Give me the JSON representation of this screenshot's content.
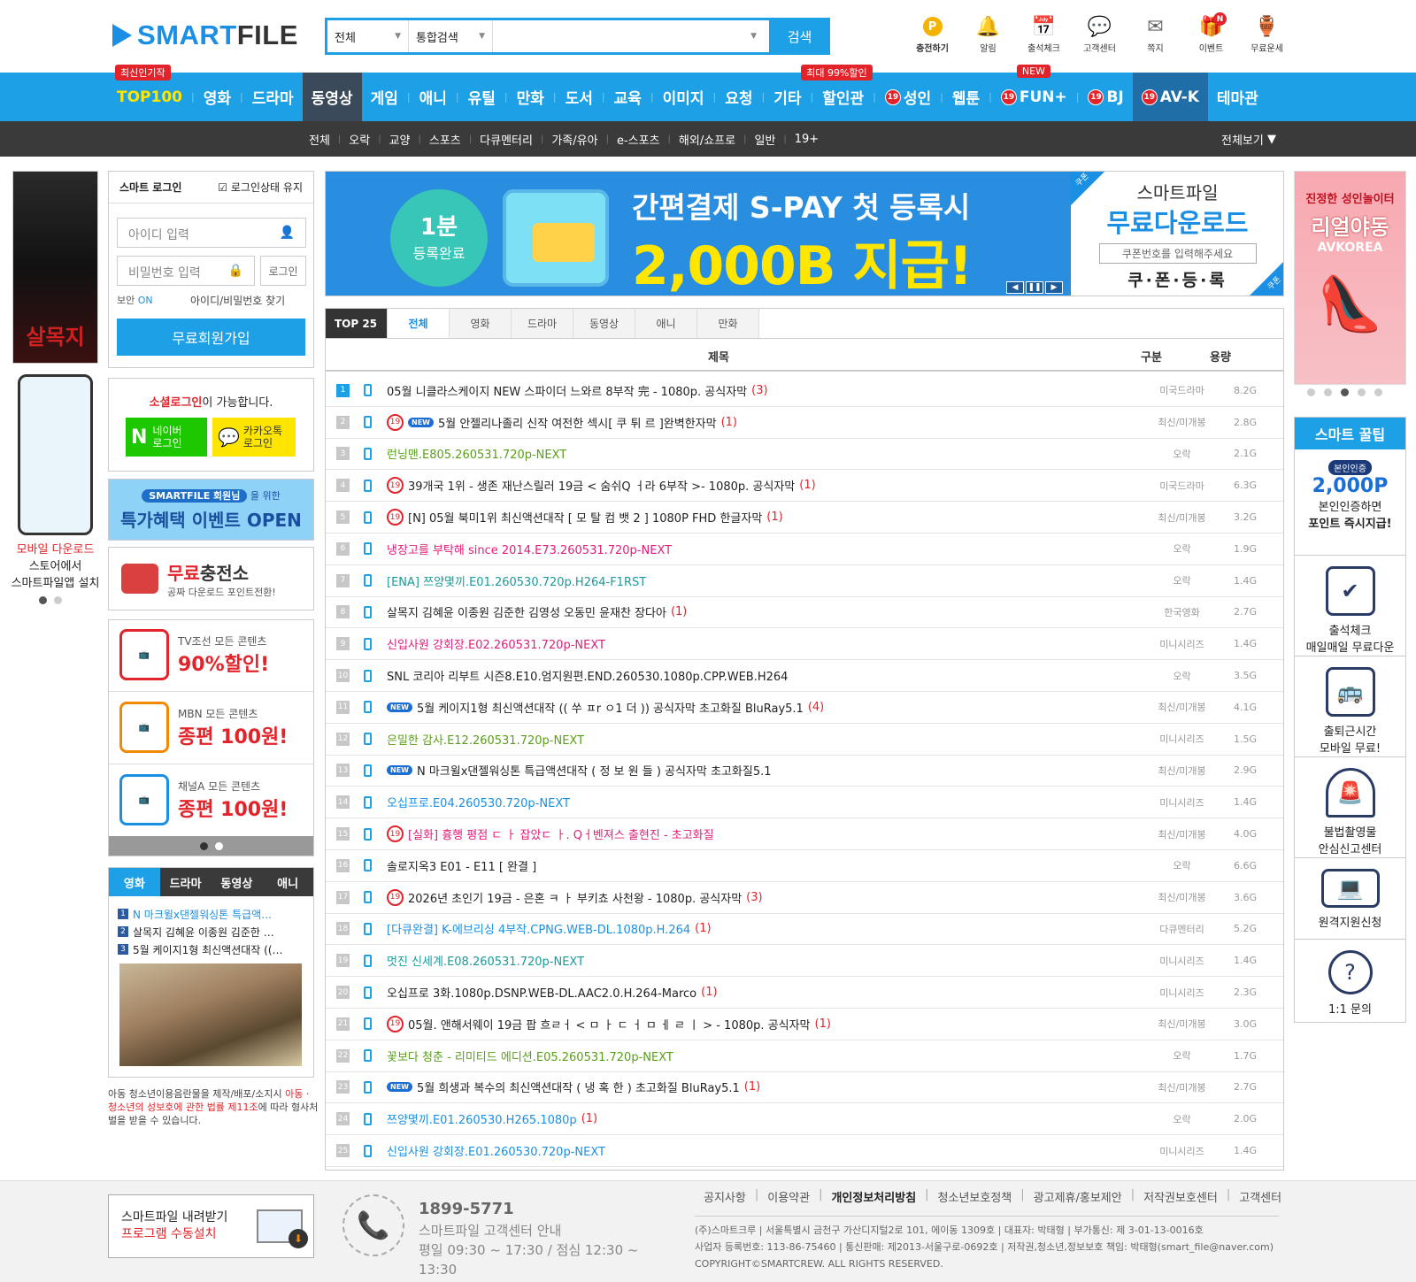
{
  "brand": {
    "name_a": "SMART",
    "name_b": "FILE",
    "primary": "#1ea0e6",
    "red": "#e2242a"
  },
  "search": {
    "scope": "전체",
    "type": "통합검색",
    "value": "",
    "button": "검색"
  },
  "top_icons": [
    {
      "icon": "point-icon",
      "label": "충전하기"
    },
    {
      "icon": "bell-icon",
      "label": "알림"
    },
    {
      "icon": "calendar-icon",
      "label": "출석체크"
    },
    {
      "icon": "chat-icon",
      "label": "고객센터"
    },
    {
      "icon": "mail-icon",
      "label": "쪽지"
    },
    {
      "icon": "gift-icon",
      "label": "이벤트",
      "badge": "N"
    },
    {
      "icon": "fortune-icon",
      "label": "무료운세"
    }
  ],
  "nav": {
    "items": [
      "TOP100",
      "영화",
      "드라마",
      "동영상",
      "게임",
      "애니",
      "유틸",
      "만화",
      "도서",
      "교육",
      "이미지",
      "요청",
      "기타",
      "할인관",
      "성인",
      "웹툰",
      "FUN+",
      "BJ",
      "AV-K",
      "테마관"
    ],
    "tag_top": "최신인기작",
    "tag_discount": "최대 99%할인",
    "tag_new": "NEW",
    "badge19": "19"
  },
  "subnav": {
    "items": [
      "전체",
      "오락",
      "교양",
      "스포츠",
      "다큐멘터리",
      "가족/유아",
      "e-스포츠",
      "해외/쇼프로",
      "일반",
      "19+"
    ],
    "view_all": "전체보기"
  },
  "left": {
    "poster_title": "살목지",
    "mobile": {
      "line1": "모바일 다운로드",
      "line2": "스토어에서",
      "line3": "스마트파일앱 설치"
    },
    "login": {
      "title": "스마트 로그인",
      "keep": "로그인상태 유지",
      "id_placeholder": "아이디 입력",
      "pw_placeholder": "비밀번호 입력",
      "button": "로그인",
      "sec_label": "보안",
      "sec_value": "ON",
      "find": "아이디/비밀번호 찾기",
      "join": "무료회원가입"
    },
    "social": {
      "title_red": "소셜로그인",
      "title_rest": "이 가능합니다.",
      "naver": "네이버\n로그인",
      "kakao": "카카오톡\n로그인"
    },
    "event": {
      "pill": "SMARTFILE 회원님",
      "pill_tail": "을 위한",
      "title": "특가혜택 이벤트 OPEN"
    },
    "free": {
      "title_red": "무료",
      "title_rest": "충전소",
      "sub": "공짜 다운로드 포인트전환!"
    },
    "promos": [
      {
        "logo": "TV조선",
        "line1": "TV조선 모든 콘텐츠",
        "line2": "90%할인!",
        "color": "#e2242a"
      },
      {
        "logo": "MBN",
        "line1": "MBN 모든 콘텐츠",
        "line2": "종편 100원!",
        "color": "#f08a00"
      },
      {
        "logo": "Channel A",
        "line1": "채널A 모든 콘텐츠",
        "line2": "종편 100원!",
        "color": "#1a8fe3"
      }
    ],
    "mini_tabs": [
      "영화",
      "드라마",
      "동영상",
      "애니"
    ],
    "mini_list": [
      "N 마크윌x댄젤워싱톤 특급액…",
      "살목지 김혜윤 이종원 김준한 …",
      "5월 케이지1형 최신액션대작 ((…"
    ],
    "notice_a": "아동 청소년이용음란물을 제작/배포/소지시",
    "notice_b": "아동 · 청소년의 성보호에 관한 법률 제11조",
    "notice_c": "에 따라 형사처벌을 받을 수 있습니다."
  },
  "hero": {
    "circle_a": "1분",
    "circle_b": "등록완료",
    "line1": "간편결제 S-PAY 첫 등록시",
    "line2": "2,000B 지급!",
    "coupon_a": "스마트파일",
    "coupon_b": "무료다운로드",
    "coupon_input": "쿠폰번호를 입력해주세요",
    "coupon_btn": "쿠·폰·등·록",
    "ribbon": "쿠폰"
  },
  "top25": {
    "label": "TOP 25",
    "tabs": [
      "전체",
      "영화",
      "드라마",
      "동영상",
      "애니",
      "만화"
    ],
    "col_title": "제목",
    "col_cat": "구분",
    "col_size": "용량"
  },
  "rows": [
    {
      "n": "1",
      "t": "05월 니클라스케이지 NEW 스파이더 느와르 8부작 完 - 1080p. 공식자막",
      "c": "(3)",
      "cat": "미국드라마",
      "sz": "8.2G",
      "col": "#222",
      "r19": false,
      "new": false
    },
    {
      "n": "2",
      "t": "5월 안젤리나졸리 신작 여전한 섹시[ 쿠 튀 르 ]완벽한자막",
      "c": "(1)",
      "cat": "최신/미개봉",
      "sz": "2.8G",
      "col": "#222",
      "r19": true,
      "new": true
    },
    {
      "n": "3",
      "t": "런닝맨.E805.260531.720p-NEXT",
      "c": "",
      "cat": "오락",
      "sz": "2.1G",
      "col": "#5a9e1a",
      "r19": false,
      "new": false
    },
    {
      "n": "4",
      "t": "39개국 1위 - 생존 재난스릴러 19금 < 숨쉬Q ㅓ라 6부작 >- 1080p. 공식자막",
      "c": "(1)",
      "cat": "미국드라마",
      "sz": "6.3G",
      "col": "#222",
      "r19": true,
      "new": false
    },
    {
      "n": "5",
      "t": "[N] 05월 북미1위 최신액션대작 [ 모 탈 컴 뱃 2 ] 1080P FHD 한글자막",
      "c": "(1)",
      "cat": "최신/미개봉",
      "sz": "3.2G",
      "col": "#222",
      "r19": true,
      "new": false
    },
    {
      "n": "6",
      "t": "냉장고를 부탁해 since 2014.E73.260531.720p-NEXT",
      "c": "",
      "cat": "오락",
      "sz": "1.9G",
      "col": "#e01e78",
      "r19": false,
      "new": false
    },
    {
      "n": "7",
      "t": "[ENA] 쯔양몇끼.E01.260530.720p.H264-F1RST",
      "c": "",
      "cat": "오락",
      "sz": "1.4G",
      "col": "#1a9a9a",
      "r19": false,
      "new": false
    },
    {
      "n": "8",
      "t": "살목지 김혜윤 이종원 김준한 김영성 오동민 윤재찬 장다아",
      "c": "(1)",
      "cat": "한국영화",
      "sz": "2.7G",
      "col": "#222",
      "r19": false,
      "new": false
    },
    {
      "n": "9",
      "t": "신입사원 강회장.E02.260531.720p-NEXT",
      "c": "",
      "cat": "미니시리즈",
      "sz": "1.4G",
      "col": "#e01e78",
      "r19": false,
      "new": false
    },
    {
      "n": "10",
      "t": "SNL 코리아 리부트 시즌8.E10.엄지원편.END.260530.1080p.CPP.WEB.H264",
      "c": "",
      "cat": "오락",
      "sz": "3.5G",
      "col": "#222",
      "r19": false,
      "new": false
    },
    {
      "n": "11",
      "t": "5월 케이지1형 최신액션대작 (( 쑤 ㅍr ㅇ1 더 )) 공식자막 초고화질 BluRay5.1",
      "c": "(4)",
      "cat": "최신/미개봉",
      "sz": "4.1G",
      "col": "#222",
      "r19": false,
      "new": true
    },
    {
      "n": "12",
      "t": "은밀한 감사.E12.260531.720p-NEXT",
      "c": "",
      "cat": "미니시리즈",
      "sz": "1.5G",
      "col": "#5a9e1a",
      "r19": false,
      "new": false
    },
    {
      "n": "13",
      "t": "N 마크윌x댄젤워싱톤 특급액션대작 ( 정 보 원 들 ) 공식자막 초고화질5.1",
      "c": "",
      "cat": "최신/미개봉",
      "sz": "2.9G",
      "col": "#222",
      "r19": false,
      "new": true
    },
    {
      "n": "14",
      "t": "오십프로.E04.260530.720p-NEXT",
      "c": "",
      "cat": "미니시리즈",
      "sz": "1.4G",
      "col": "#1a8fe3",
      "r19": false,
      "new": false
    },
    {
      "n": "15",
      "t": "[실화] 흉행 평점 ㄷ ㅏ 잡았ㄷ ㅏ. Qㅓ벤져스 출현진 - 초고화질",
      "c": "",
      "cat": "최신/미개봉",
      "sz": "4.0G",
      "col": "#e01e78",
      "r19": true,
      "new": false
    },
    {
      "n": "16",
      "t": "솔로지옥3 E01 - E11 [ 완결 ]",
      "c": "",
      "cat": "오락",
      "sz": "6.6G",
      "col": "#222",
      "r19": false,
      "new": false
    },
    {
      "n": "17",
      "t": "2026년 초인기 19금 - 은혼 ㅋ ㅏ 부키쵸 사천왕 - 1080p. 공식자막",
      "c": "(3)",
      "cat": "최신/미개봉",
      "sz": "3.6G",
      "col": "#222",
      "r19": true,
      "new": false
    },
    {
      "n": "18",
      "t": "[다큐완결] K-에브리싱 4부작.CPNG.WEB-DL.1080p.H.264",
      "c": "(1)",
      "cat": "다큐멘터리",
      "sz": "5.2G",
      "col": "#1a8fe3",
      "r19": false,
      "new": false
    },
    {
      "n": "19",
      "t": "멋진 신세계.E08.260531.720p-NEXT",
      "c": "",
      "cat": "미니시리즈",
      "sz": "1.4G",
      "col": "#1a9a9a",
      "r19": false,
      "new": false
    },
    {
      "n": "20",
      "t": "오십프로 3화.1080p.DSNP.WEB-DL.AAC2.0.H.264-Marco",
      "c": "(1)",
      "cat": "미니시리즈",
      "sz": "2.3G",
      "col": "#222",
      "r19": false,
      "new": false
    },
    {
      "n": "21",
      "t": "05월. 앤해서웨이 19금 팝 흐ㄹㅓ < ㅁ ㅏ ㄷ ㅓ ㅁ ㅔ ㄹ ㅣ > - 1080p. 공식자막",
      "c": "(1)",
      "cat": "최신/미개봉",
      "sz": "3.0G",
      "col": "#222",
      "r19": true,
      "new": false
    },
    {
      "n": "22",
      "t": "꽃보다 청춘 - 리미티드 에디션.E05.260531.720p-NEXT",
      "c": "",
      "cat": "오락",
      "sz": "1.7G",
      "col": "#5a9e1a",
      "r19": false,
      "new": false
    },
    {
      "n": "23",
      "t": "5월 희생과 복수의 최신액션대작 ( 냉 혹 한 ) 초고화질 BluRay5.1",
      "c": "(1)",
      "cat": "최신/미개봉",
      "sz": "2.7G",
      "col": "#222",
      "r19": false,
      "new": true
    },
    {
      "n": "24",
      "t": "쯔양몇끼.E01.260530.H265.1080p",
      "c": "(1)",
      "cat": "오락",
      "sz": "2.0G",
      "col": "#1a8fe3",
      "r19": false,
      "new": false
    },
    {
      "n": "25",
      "t": "신입사원 강회장.E01.260530.720p-NEXT",
      "c": "",
      "cat": "미니시리즈",
      "sz": "1.4G",
      "col": "#1a8fe3",
      "r19": false,
      "new": false
    }
  ],
  "right": {
    "banner_a": "진정한 성인놀이터",
    "banner_b": "리얼야동",
    "banner_c": "AVKOREA",
    "tips_title": "스마트 꿀팁",
    "tips": [
      {
        "icon": "point-badge-icon",
        "a": "본인인증",
        "pt": "2,000P",
        "b": "본인인증하면",
        "c": "포인트 즉시지급!"
      },
      {
        "icon": "calendar-check-icon",
        "a": "출석체크",
        "b": "매일매일 무료다운"
      },
      {
        "icon": "bus-icon",
        "a": "출퇴근시간",
        "b": "모바일 무료!"
      },
      {
        "icon": "alarm-light-icon",
        "a": "불법촬영물",
        "b": "안심신고센터"
      },
      {
        "icon": "remote-support-icon",
        "a": "원격지원신청",
        "b": ""
      },
      {
        "icon": "question-icon",
        "a": "1:1 문의",
        "b": ""
      }
    ]
  },
  "footer": {
    "dl_a": "스마트파일 내려받기",
    "dl_b": "프로그램 수동설치",
    "cs_phone": "1899-5771",
    "cs_a": "스마트파일 고객센터 안내",
    "cs_b": "평일 09:30 ~ 17:30 / 점심 12:30 ~ 13:30",
    "links": [
      "공지사항",
      "이용약관",
      "개인정보처리방침",
      "청소년보호정책",
      "광고제휴/홍보제안",
      "저작권보호센터",
      "고객센터"
    ],
    "info1": "(주)스마트크루 | 서울특별시 금천구 가산디지털2로 101, 에이동 1309호 | 대표자: 박태형 | 부가통신: 제 3-01-13-0016호",
    "info2": "사업자 등록번호: 113-86-75460 | 통신판매: 제2013-서울구로-0692호 | 저작권,청소년,정보보호 책임: 박태형(smart_file@naver.com)",
    "info3": "COPYRIGHT©SMARTCREW. ALL RIGHTS RESERVED."
  }
}
